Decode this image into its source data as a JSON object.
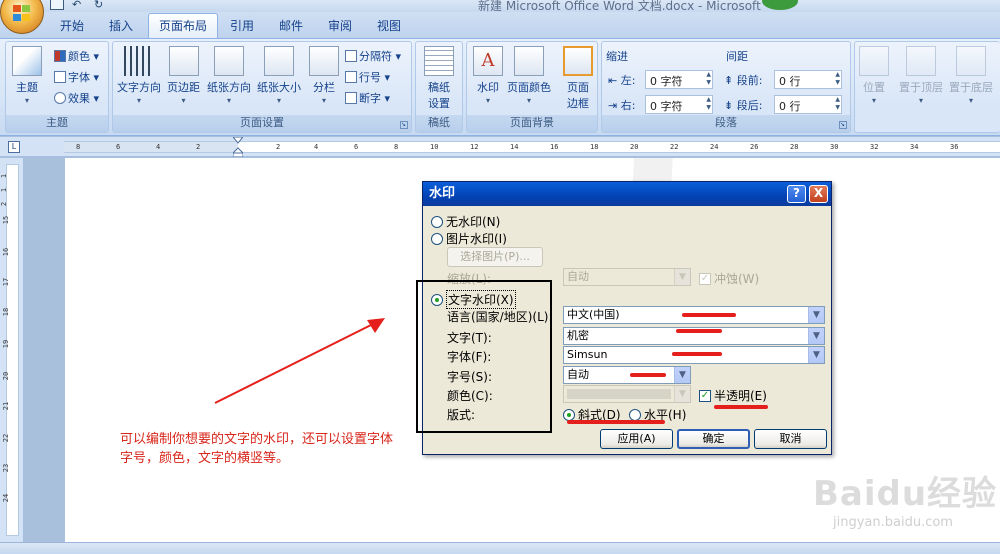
{
  "window": {
    "title": "新建 Microsoft Office Word 文档.docx - Microsoft"
  },
  "tabs": [
    "开始",
    "插入",
    "页面布局",
    "引用",
    "邮件",
    "审阅",
    "视图"
  ],
  "active_tab": "页面布局",
  "ribbon": {
    "theme_group": {
      "label": "主题",
      "theme_button": "主题",
      "colors": "颜色",
      "fonts": "字体",
      "effects": "效果"
    },
    "page_setup_group": {
      "label": "页面设置",
      "text_direction": "文字方向",
      "margins": "页边距",
      "orientation": "纸张方向",
      "size": "纸张大小",
      "columns": "分栏",
      "breaks": "分隔符",
      "line_numbers": "行号",
      "hyphenation": "断字"
    },
    "draft_group": {
      "label": "稿纸",
      "draft_line1": "稿纸",
      "draft_line2": "设置"
    },
    "page_background_group": {
      "label": "页面背景",
      "watermark": "水印",
      "page_color": "页面颜色",
      "page_borders_line1": "页面",
      "page_borders_line2": "边框"
    },
    "paragraph_group": {
      "label": "段落",
      "indent_header": "缩进",
      "indent_left_label": "左:",
      "indent_left_value": "0 字符",
      "indent_right_label": "右:",
      "indent_right_value": "0 字符",
      "spacing_header": "间距",
      "spacing_before_label": "段前:",
      "spacing_before_value": "0 行",
      "spacing_after_label": "段后:",
      "spacing_after_value": "0 行"
    },
    "arrange_group": {
      "position": "位置",
      "bring_front": "置于顶层",
      "send_back": "置于底层"
    }
  },
  "ruler": {
    "corner": "L",
    "h_ticks": [
      "8",
      "6",
      "4",
      "2",
      "2",
      "4",
      "6",
      "8",
      "10",
      "12",
      "14",
      "16",
      "18",
      "20",
      "22",
      "24",
      "26",
      "28",
      "30",
      "32",
      "34",
      "36"
    ],
    "v_ticks": [
      "1",
      "1",
      "2",
      "15",
      "16",
      "17",
      "18",
      "19",
      "20",
      "21",
      "22",
      "23",
      "24"
    ]
  },
  "document": {
    "annotation_line1": "可以编制你想要的文字的水印，还可以设置字体",
    "annotation_line2": "字号，颜色，文字的横竖等。",
    "baidu_logo": "Baidu经验",
    "baidu_url": "jingyan.baidu.com"
  },
  "dialog": {
    "title": "水印",
    "help_glyph": "?",
    "close_glyph": "X",
    "no_watermark": "无水印(N)",
    "picture_watermark": "图片水印(I)",
    "select_picture": "选择图片(P)...",
    "scale_label": "缩放(L):",
    "scale_value": "自动",
    "washout": "冲蚀(W)",
    "text_watermark": "文字水印(X)",
    "language_label": "语言(国家/地区)(L):",
    "language_value": "中文(中国)",
    "text_label": "文字(T):",
    "text_value": "机密",
    "font_label": "字体(F):",
    "font_value": "Simsun",
    "size_label": "字号(S):",
    "size_value": "自动",
    "color_label": "颜色(C):",
    "semitransparent": "半透明(E)",
    "layout_label": "版式:",
    "diagonal": "斜式(D)",
    "horizontal": "水平(H)",
    "apply": "应用(A)",
    "ok": "确定",
    "cancel": "取消",
    "selected_type": "text",
    "selected_layout": "diagonal",
    "semitransparent_checked": true,
    "washout_checked": true
  },
  "colors": {
    "annotation_red": "#d8261b",
    "dialog_title_blue": "#0342b5",
    "radio_green": "#21a121"
  }
}
